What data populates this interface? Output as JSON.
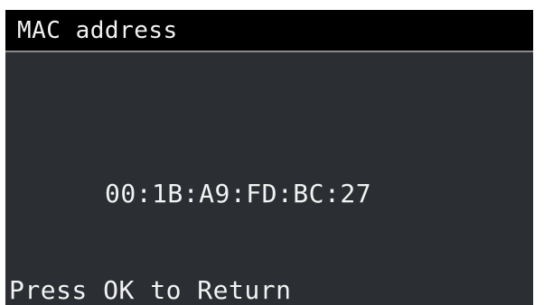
{
  "screen": {
    "title": "MAC address",
    "mac_address": "00:1B:A9:FD:BC:27",
    "footer_hint": "Press OK to Return"
  },
  "colors": {
    "title_bar_bg": "#000000",
    "screen_bg": "#2b2f33",
    "text": "#f2f2f2"
  }
}
